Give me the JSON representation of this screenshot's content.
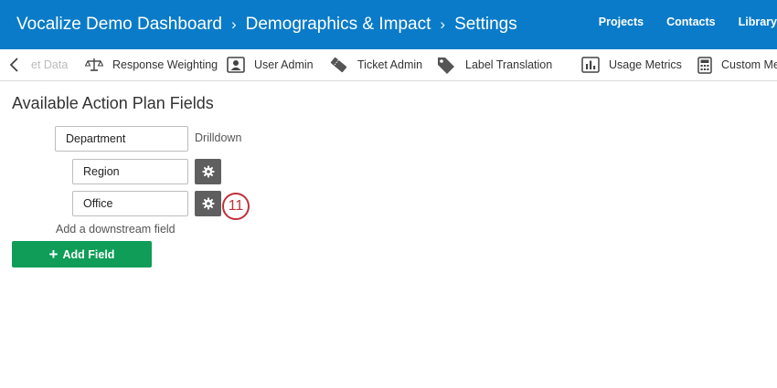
{
  "header": {
    "breadcrumbs": [
      "Vocalize Demo Dashboard",
      "Demographics & Impact",
      "Settings"
    ],
    "nav": [
      "Projects",
      "Contacts",
      "Library"
    ],
    "bg_color": "#0a7bc8"
  },
  "toolbar": {
    "items": [
      {
        "label": "et Data",
        "icon": "import-data-icon"
      },
      {
        "label": "Response Weighting",
        "icon": "scale-icon"
      },
      {
        "label": "User Admin",
        "icon": "user-card-icon"
      },
      {
        "label": "Ticket Admin",
        "icon": "ticket-icon"
      },
      {
        "label": "Label Translation",
        "icon": "tag-icon"
      },
      {
        "label": "Usage Metrics",
        "icon": "bar-chart-icon"
      },
      {
        "label": "Custom Me",
        "icon": "calculator-icon"
      }
    ]
  },
  "main": {
    "title": "Available Action Plan Fields",
    "top_field": {
      "value": "Department",
      "tag": "Drilldown"
    },
    "sub_fields": [
      {
        "value": "Region"
      },
      {
        "value": "Office"
      }
    ],
    "annotation_badge": "11",
    "downstream_link": "Add a downstream field",
    "add_button": {
      "label": "Add Field",
      "color": "#0f9d58"
    }
  }
}
